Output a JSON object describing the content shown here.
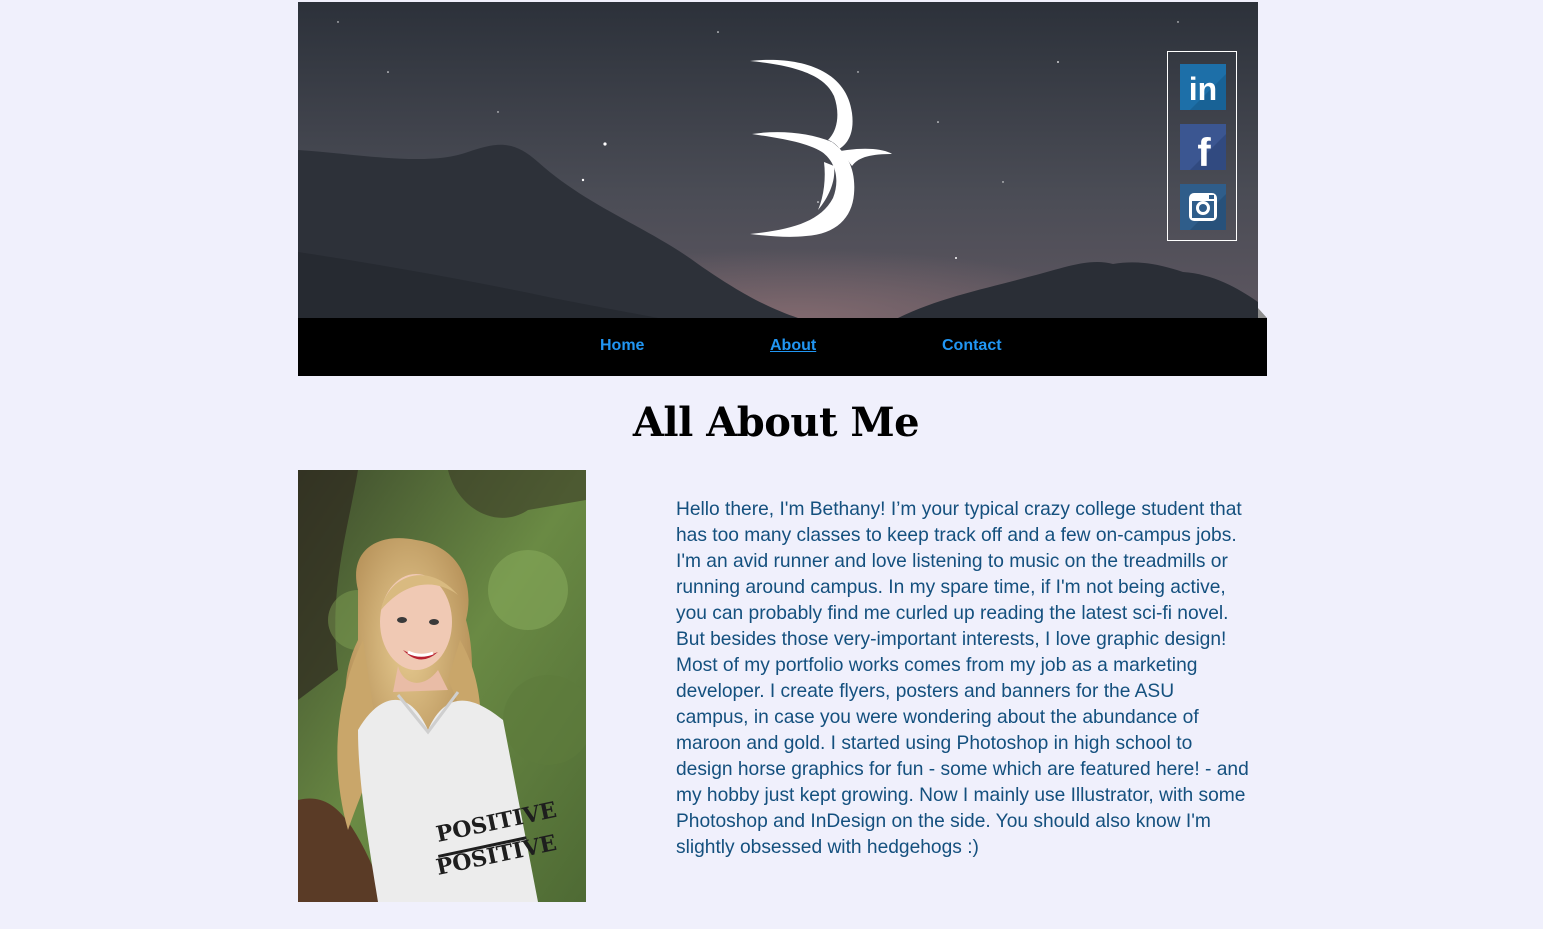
{
  "header": {
    "logo_icon": "script-letter-b-logo",
    "social": [
      {
        "name": "LinkedIn",
        "icon": "linkedin-icon",
        "glyph": "in",
        "color": "#1d6fa8"
      },
      {
        "name": "Facebook",
        "icon": "facebook-icon",
        "glyph": "f",
        "color": "#3b5691"
      },
      {
        "name": "Instagram",
        "icon": "instagram-icon",
        "glyph": "",
        "color": "#2f5d8a"
      }
    ]
  },
  "nav": {
    "items": [
      {
        "label": "Home",
        "active": false
      },
      {
        "label": "About",
        "active": true
      },
      {
        "label": "Contact",
        "active": false
      }
    ],
    "link_color": "#2196f3"
  },
  "main": {
    "title": "All About Me",
    "bio": "Hello there, I'm Bethany! I’m your typical crazy college student that has too many classes to keep track off and a few on-campus jobs. I'm an avid runner and love listening to music on the treadmills or running around campus. In my spare time, if I'm not being active, you can probably find me curled up reading the latest sci-fi novel. But besides those very-important interests, I love graphic design! Most of my portfolio works comes from my job as a marketing developer. I create flyers, posters and banners for the ASU campus, in case you were wondering about the abundance of maroon and gold. I started using Photoshop in high school to design horse graphics for fun - some which are featured here! - and my hobby just kept growing. Now I mainly use Illustrator, with some Photoshop and InDesign on the side. You should also know I'm slightly obsessed with hedgehogs :)",
    "bio_color": "#14507e"
  }
}
